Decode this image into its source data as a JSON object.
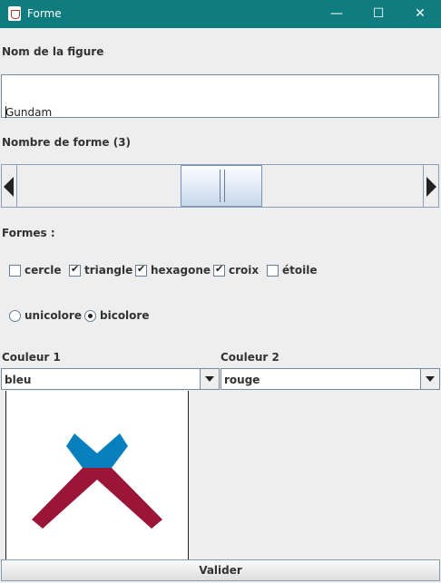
{
  "window": {
    "title": "Forme",
    "minimize": "—",
    "maximize": "☐",
    "close": "✕"
  },
  "name_label": "Nom de la figure",
  "name_value": "Gundam",
  "count_label": "Nombre de forme (3)",
  "slider": {
    "value_fraction": 0.5
  },
  "shapes_label": "Formes :",
  "shapes": [
    {
      "label": "cercle",
      "checked": false
    },
    {
      "label": "triangle",
      "checked": true
    },
    {
      "label": "hexagone",
      "checked": true
    },
    {
      "label": "croix",
      "checked": true
    },
    {
      "label": "étoile",
      "checked": false
    }
  ],
  "color_mode": [
    {
      "label": "unicolore",
      "selected": false
    },
    {
      "label": "bicolore",
      "selected": true
    }
  ],
  "color1_label": "Couleur 1",
  "color1_value": "bleu",
  "color2_label": "Couleur 2",
  "color2_value": "rouge",
  "colors": {
    "bleu": "#0a7fbd",
    "rouge": "#9b1537",
    "titlebar": "#0f7d7f"
  },
  "submit_label": "Valider"
}
